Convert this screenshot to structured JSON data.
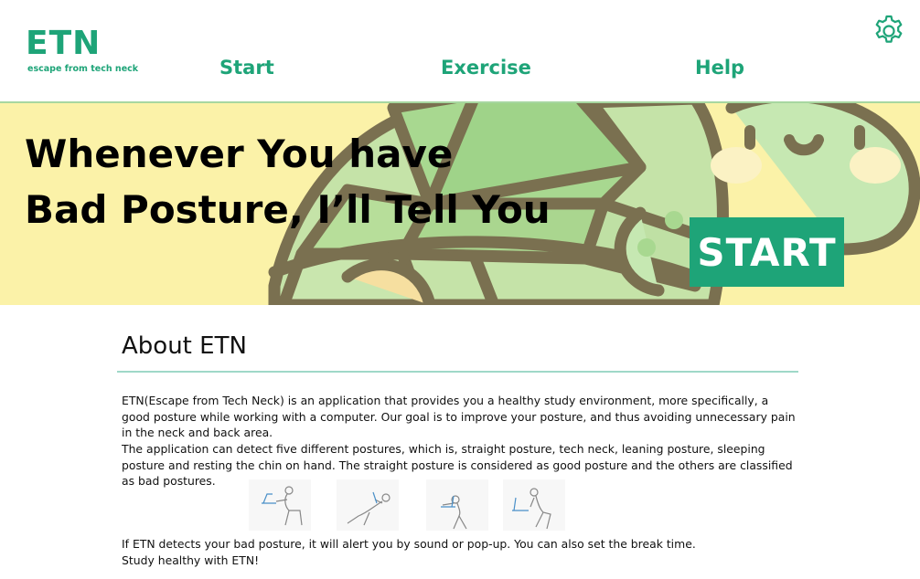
{
  "header": {
    "logo_title": "ETN",
    "logo_subtitle": "escape from tech neck",
    "nav": [
      {
        "label": "Start"
      },
      {
        "label": "Exercise"
      },
      {
        "label": "Help"
      }
    ],
    "settings_icon": "gear-icon"
  },
  "hero": {
    "title_line1": "Whenever You have",
    "title_line2": "Bad Posture, I’ll Tell You",
    "start_label": "START",
    "illustration": "turtle-illustration"
  },
  "about": {
    "title": "About ETN",
    "paragraph1": " ETN(Escape from Tech Neck) is an application that provides you a healthy study environment, more specifically, a good posture while working with a computer. Our goal is to improve your posture, and thus avoiding unnecessary pain in the neck and back area.",
    "paragraph2": " The application can detect five different postures, which is, straight posture, tech neck, leaning posture, sleeping posture and resting the chin on hand. The straight posture is considered as good posture and the others are classified as bad postures.",
    "posture_images": [
      "tech-neck-posture-image",
      "leaning-posture-image",
      "sleeping-posture-image",
      "chin-on-hand-posture-image"
    ],
    "closing_line1": " If ETN detects your bad posture, it will alert you by sound or pop-up. You can also set the break time.",
    "closing_line2": " Study healthy with ETN!"
  },
  "colors": {
    "brand_green": "#1ea478",
    "hero_background": "#fbf2a8",
    "turtle_outline": "#7a7050"
  }
}
